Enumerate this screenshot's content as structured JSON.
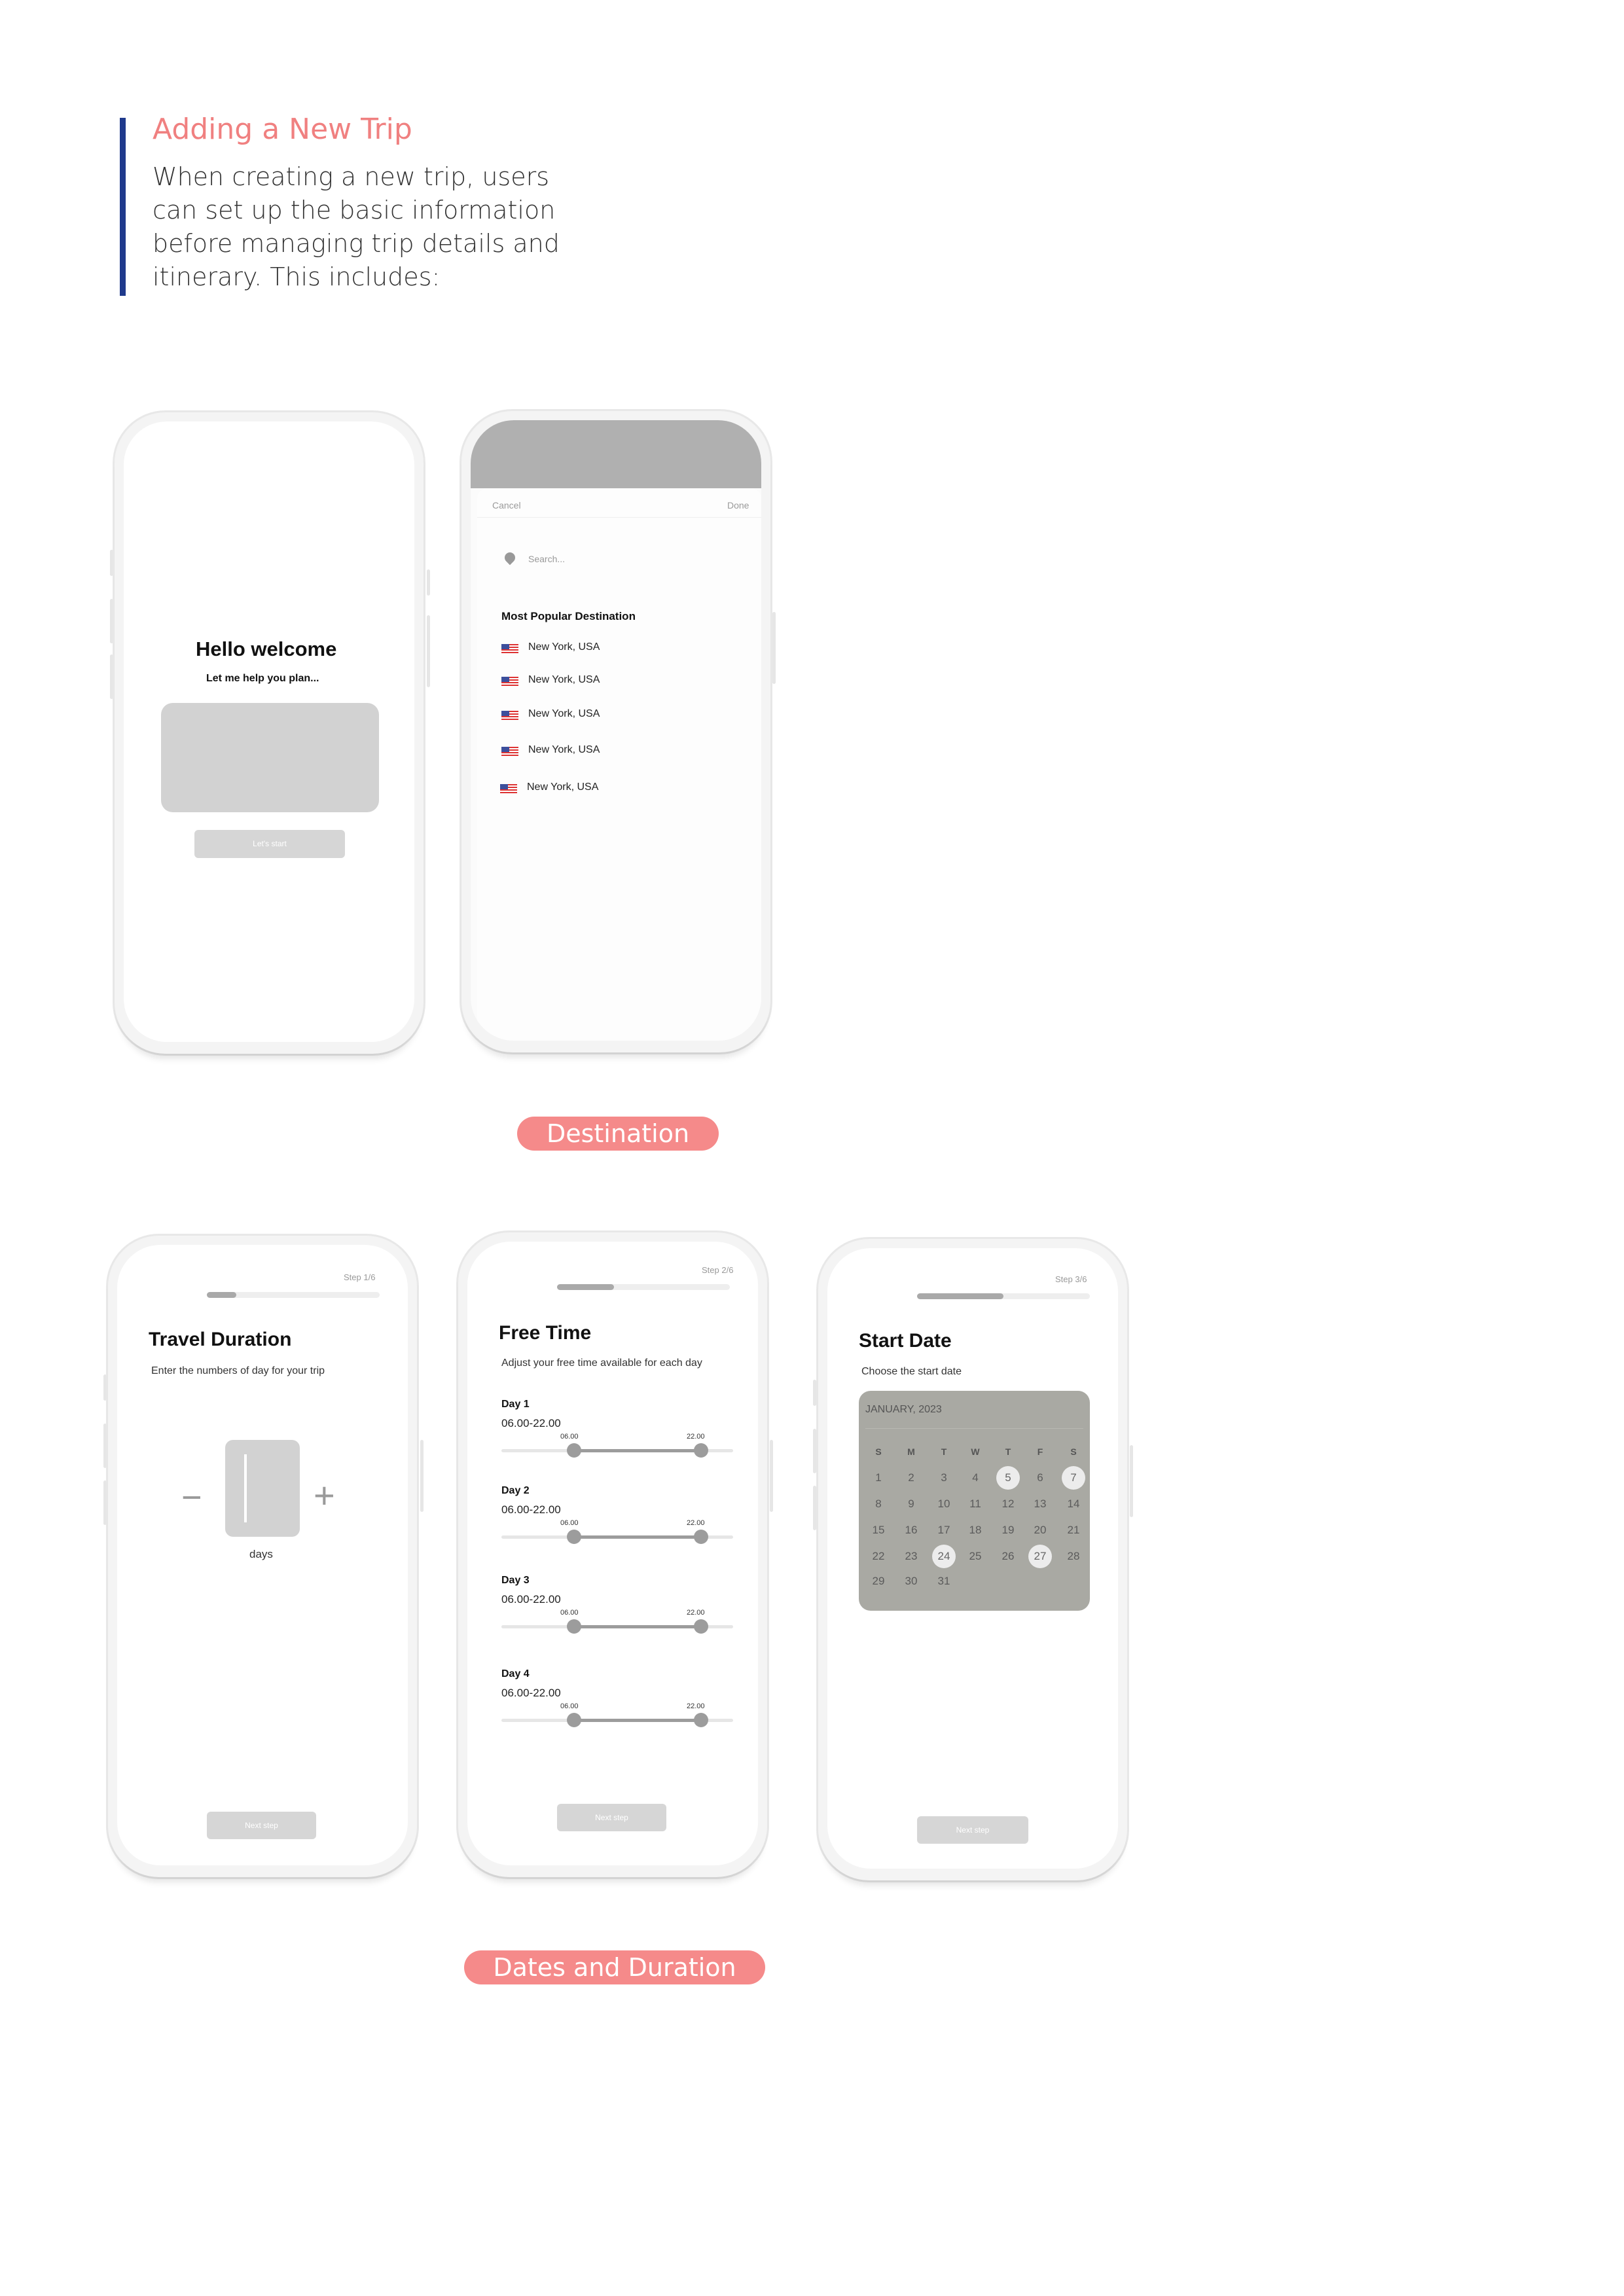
{
  "intro": {
    "title": "Adding a New Trip",
    "body": "When creating a new trip, users can set up the basic information before managing trip details and itinerary. This includes:"
  },
  "welcome": {
    "title": "Hello welcome",
    "subtitle": "Let me help you plan...",
    "button": "Let's start"
  },
  "destination": {
    "cancel": "Cancel",
    "done": "Done",
    "search_placeholder": "Search...",
    "section_title": "Most Popular Destination",
    "items": [
      "New York, USA",
      "New York, USA",
      "New York, USA",
      "New York, USA",
      "New York, USA"
    ],
    "caption": "Destination"
  },
  "duration": {
    "step": "Step 1/6",
    "progress": 0.17,
    "title": "Travel Duration",
    "subtitle": "Enter the numbers of day for your trip",
    "minus": "−",
    "plus": "+",
    "unit": "days",
    "button": "Next step"
  },
  "free_time": {
    "step": "Step 2/6",
    "progress": 0.33,
    "title": "Free Time",
    "subtitle": "Adjust your free time available for each day",
    "days": [
      {
        "label": "Day 1",
        "range": "06.00-22.00",
        "start": "06.00",
        "end": "22.00"
      },
      {
        "label": "Day 2",
        "range": "06.00-22.00",
        "start": "06.00",
        "end": "22.00"
      },
      {
        "label": "Day 3",
        "range": "06.00-22.00",
        "start": "06.00",
        "end": "22.00"
      },
      {
        "label": "Day 4",
        "range": "06.00-22.00",
        "start": "06.00",
        "end": "22.00"
      }
    ],
    "button": "Next step"
  },
  "start_date": {
    "step": "Step 3/6",
    "progress": 0.5,
    "title": "Start Date",
    "subtitle": "Choose the start date",
    "month": "JANUARY, 2023",
    "weekdays": [
      "S",
      "M",
      "T",
      "W",
      "T",
      "F",
      "S"
    ],
    "selected": [
      "5",
      "7",
      "24",
      "27"
    ],
    "button": "Next step"
  },
  "caption_dates": "Dates and Duration"
}
